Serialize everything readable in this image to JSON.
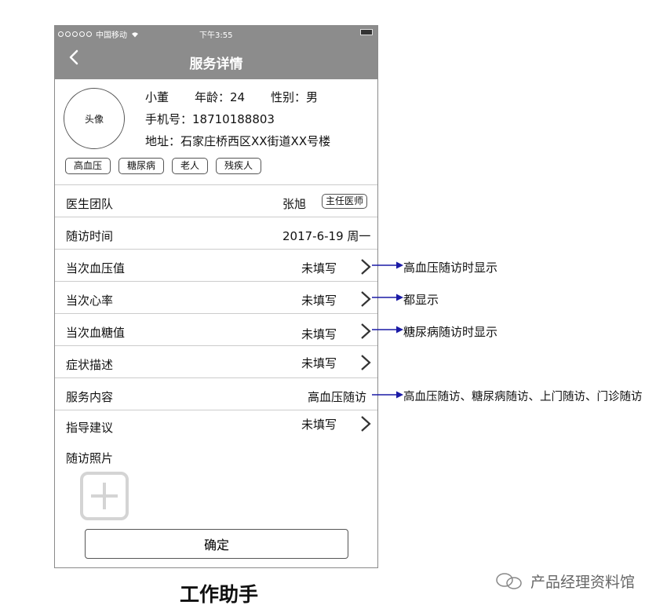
{
  "status_bar": {
    "carrier": "中国移动",
    "time": "下午3:55"
  },
  "nav": {
    "title": "服务详情"
  },
  "profile": {
    "avatar_label": "头像",
    "name": "小董",
    "age": "年龄：24",
    "gender": "性别：男",
    "phone": "手机号：18710188803",
    "address": "地址：石家庄桥西区XX街道XX号楼",
    "tags": [
      "高血压",
      "糖尿病",
      "老人",
      "残疾人"
    ]
  },
  "rows": {
    "doctor_team": {
      "label": "医生团队",
      "value": "张旭",
      "badge": "主任医师"
    },
    "visit_time": {
      "label": "随访时间",
      "value": "2017-6-19 周一"
    },
    "blood_pressure": {
      "label": "当次血压值",
      "value": "未填写"
    },
    "heart_rate": {
      "label": "当次心率",
      "value": "未填写"
    },
    "blood_sugar": {
      "label": "当次血糖值",
      "value": "未填写"
    },
    "symptoms": {
      "label": "症状描述",
      "value": "未填写"
    },
    "service_content": {
      "label": "服务内容",
      "value": "高血压随访"
    },
    "guidance": {
      "label": "指导建议",
      "value": "未填写"
    },
    "photos": {
      "label": "随访照片"
    }
  },
  "confirm_label": "确定",
  "annotations": {
    "bp": "高血压随访时显示",
    "hr": "都显示",
    "bs": "糖尿病随访时显示",
    "service": "高血压随访、糖尿病随访、上门随访、门诊随访"
  },
  "caption": "工作助手",
  "watermark": "产品经理资料馆",
  "colors": {
    "bar": "#8c8c8c",
    "arrow": "#1a1aa6"
  }
}
